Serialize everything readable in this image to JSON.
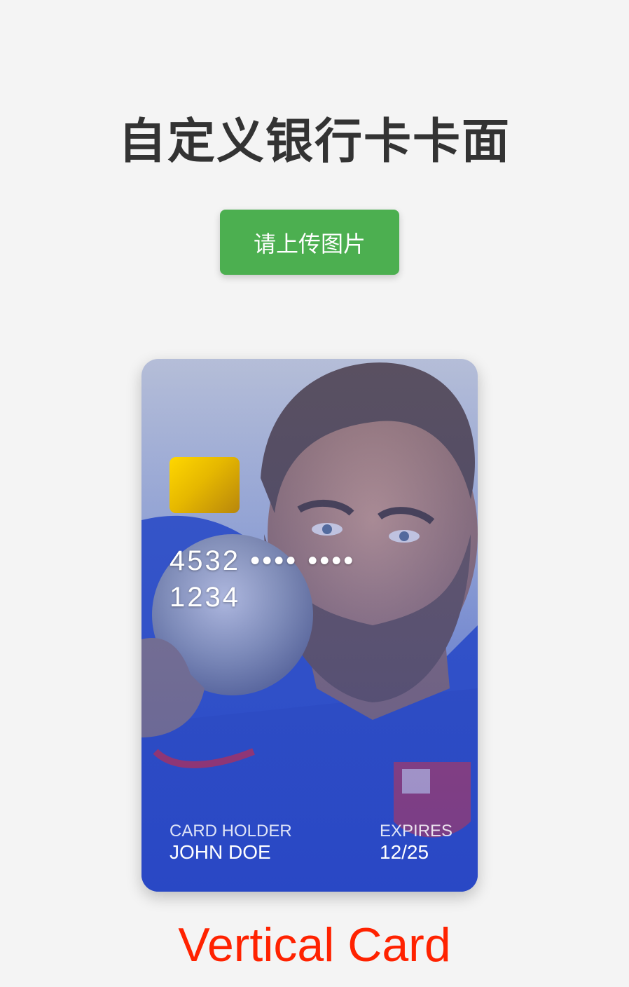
{
  "header": {
    "title": "自定义银行卡卡面"
  },
  "upload": {
    "label": "请上传图片",
    "color": "#4caf50"
  },
  "card": {
    "number": "4532 •••• •••• 1234",
    "holder_label": "CARD HOLDER",
    "holder_name": "JOHN DOE",
    "expires_label": "EXPIRES",
    "expires_value": "12/25",
    "chip_icon": "chip-icon",
    "background": "photo of bearded shot-put athlete in blue jersey"
  },
  "caption": {
    "text": "Vertical Card",
    "color": "#ff2200"
  }
}
